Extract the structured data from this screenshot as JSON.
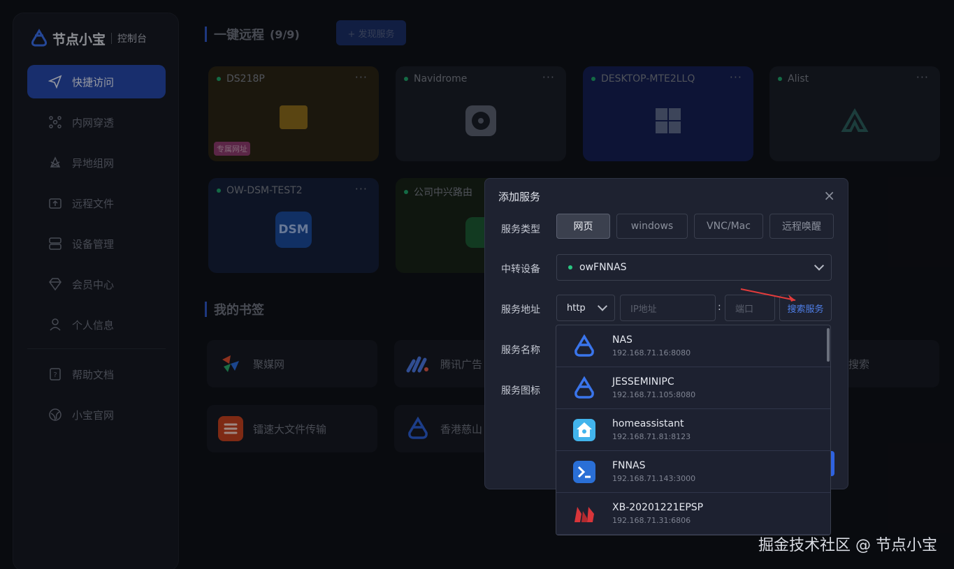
{
  "app": {
    "title": "节点小宝",
    "subtitle": "控制台"
  },
  "sidebar": {
    "items": [
      {
        "label": "快捷访问",
        "icon": "paper-plane-icon",
        "active": true
      },
      {
        "label": "内网穿透",
        "icon": "network-icon"
      },
      {
        "label": "异地组网",
        "icon": "mesh-icon"
      },
      {
        "label": "远程文件",
        "icon": "folder-upload-icon"
      },
      {
        "label": "设备管理",
        "icon": "server-icon"
      },
      {
        "label": "会员中心",
        "icon": "diamond-icon"
      },
      {
        "label": "个人信息",
        "icon": "user-icon"
      },
      {
        "label": "帮助文档",
        "icon": "help-doc-icon"
      },
      {
        "label": "小宝官网",
        "icon": "globe-icon"
      }
    ]
  },
  "remote": {
    "title": "一键远程",
    "count": "(9/9)",
    "discover_label": "+ 发现服务",
    "cards": [
      {
        "name": "DS218P",
        "badge": "专属网址"
      },
      {
        "name": "Navidrome"
      },
      {
        "name": "DESKTOP-MTE2LLQ"
      },
      {
        "name": "Alist"
      },
      {
        "name": "OW-DSM-TEST2",
        "icon_text": "DSM"
      },
      {
        "name": "公司中兴路由"
      }
    ]
  },
  "bookmarks": {
    "title": "我的书签",
    "items": [
      {
        "label": "聚媒网"
      },
      {
        "label": "腾讯广告"
      },
      {
        "label": "搜索"
      },
      {
        "label": "镭速大文件传输"
      },
      {
        "label": "香港慈山"
      }
    ]
  },
  "modal": {
    "title": "添加服务",
    "close": "×",
    "labels": {
      "type": "服务类型",
      "relay": "中转设备",
      "address": "服务地址",
      "name": "服务名称",
      "icon": "服务图标"
    },
    "types": [
      "网页",
      "windows",
      "VNC/Mac",
      "远程唤醒"
    ],
    "active_type": "网页",
    "relay_device": "owFNNAS",
    "protocol": "http",
    "ip_placeholder": "IP地址",
    "colon": ":",
    "port_placeholder": "端口",
    "search_label": "搜索服务",
    "results": [
      {
        "name": "NAS",
        "addr": "192.168.71.16:8080",
        "icon": "ddnsto-icon"
      },
      {
        "name": "JESSEMINIPC",
        "addr": "192.168.71.105:8080",
        "icon": "ddnsto-icon"
      },
      {
        "name": "homeassistant",
        "addr": "192.168.71.81:8123",
        "icon": "home-assistant-icon"
      },
      {
        "name": "FNNAS",
        "addr": "192.168.71.143:3000",
        "icon": "terminal-icon"
      },
      {
        "name": "XB-20201221EPSP",
        "addr": "192.168.71.31:6806",
        "icon": "red-m-icon"
      }
    ]
  },
  "watermark": "掘金技术社区 @ 节点小宝",
  "colors": {
    "accent": "#2547a8",
    "link": "#4f7fe8",
    "online": "#2ac782"
  }
}
